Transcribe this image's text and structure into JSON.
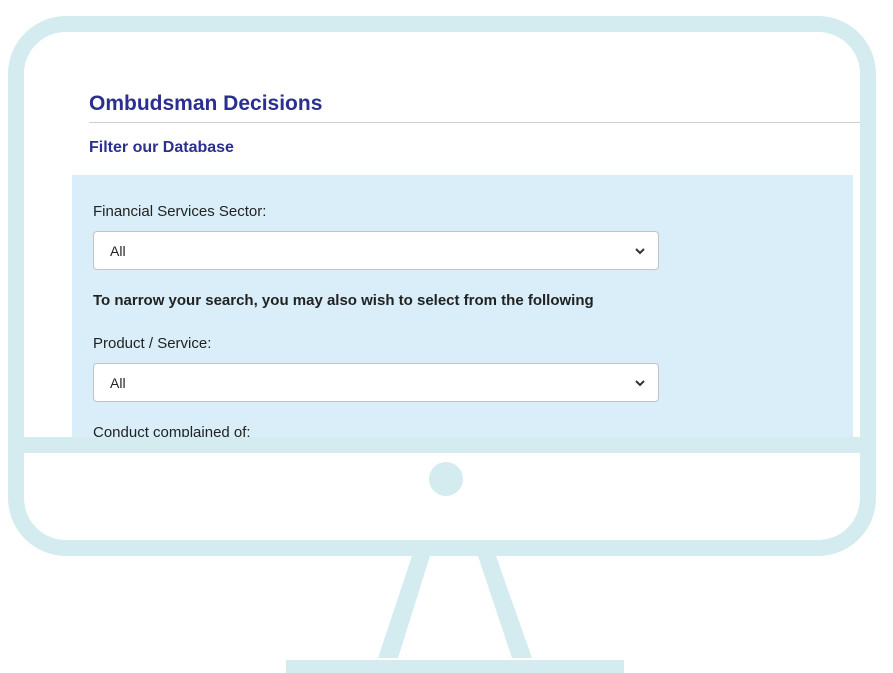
{
  "page": {
    "title": "Ombudsman Decisions",
    "subtitle": "Filter our Database"
  },
  "filters": {
    "sector_label": "Financial Services Sector:",
    "sector_value": "All",
    "narrow_hint": "To narrow your search, you may also wish to select from the following",
    "product_label": "Product / Service:",
    "product_value": "All",
    "conduct_label": "Conduct complained of:"
  },
  "icons": {
    "dropdown": "chevron-down-icon",
    "power": "power-indicator"
  },
  "colors": {
    "monitor_frame": "#d4ebf0",
    "heading": "#2b2f8f",
    "panel_background": "#d9eef8"
  }
}
